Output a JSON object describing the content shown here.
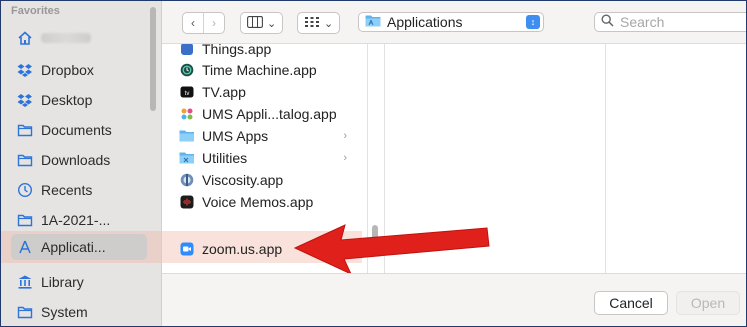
{
  "sidebar": {
    "section_title": "Favorites",
    "items": [
      {
        "label": "",
        "icon": "home-icon"
      },
      {
        "label": "Dropbox",
        "icon": "dropbox-icon"
      },
      {
        "label": "Desktop",
        "icon": "dropbox-icon"
      },
      {
        "label": "Documents",
        "icon": "folder-icon"
      },
      {
        "label": "Downloads",
        "icon": "folder-icon"
      },
      {
        "label": "Recents",
        "icon": "clock-icon"
      },
      {
        "label": "1A-2021-...",
        "icon": "folder-icon"
      },
      {
        "label": "Applicati...",
        "icon": "applications-icon",
        "selected": true
      },
      {
        "label": "Library",
        "icon": "library-icon"
      },
      {
        "label": "System",
        "icon": "folder-icon"
      }
    ]
  },
  "toolbar": {
    "back_icon": "chevron-left-icon",
    "forward_icon": "chevron-right-icon",
    "view_columns_icon": "columns-icon",
    "view_grid_icon": "grid-icon",
    "location": "Applications",
    "search_placeholder": "Search"
  },
  "files": [
    {
      "name": "Things.app",
      "icon": "app-icon",
      "partial": true
    },
    {
      "name": "Time Machine.app",
      "icon": "time-machine-icon"
    },
    {
      "name": "TV.app",
      "icon": "tv-icon"
    },
    {
      "name": "UMS Appli...talog.app",
      "icon": "app-icon"
    },
    {
      "name": "UMS Apps",
      "icon": "folder-icon",
      "has_children": true
    },
    {
      "name": "Utilities",
      "icon": "folder-icon",
      "has_children": true
    },
    {
      "name": "Viscosity.app",
      "icon": "viscosity-icon"
    },
    {
      "name": "Voice Memos.app",
      "icon": "voice-memos-icon"
    },
    {
      "name": "zoom.us.app",
      "icon": "zoom-icon",
      "highlighted": true
    }
  ],
  "footer": {
    "cancel_label": "Cancel",
    "open_label": "Open"
  },
  "colors": {
    "accent": "#3d8ef0",
    "annotation_arrow": "#e0201b",
    "highlight": "#eeb2a0"
  }
}
